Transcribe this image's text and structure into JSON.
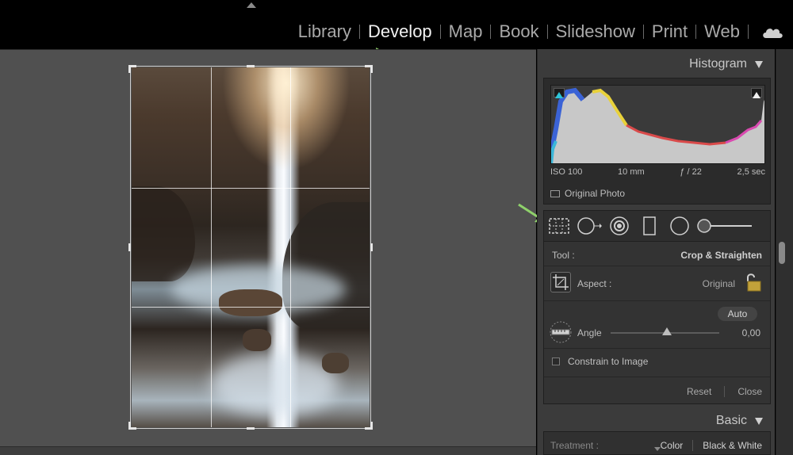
{
  "modules": {
    "items": [
      {
        "label": "Library",
        "active": false
      },
      {
        "label": "Develop",
        "active": true
      },
      {
        "label": "Map",
        "active": false
      },
      {
        "label": "Book",
        "active": false
      },
      {
        "label": "Slideshow",
        "active": false
      },
      {
        "label": "Print",
        "active": false
      },
      {
        "label": "Web",
        "active": false
      }
    ],
    "cloud_icon": "cloud-icon"
  },
  "histogram": {
    "title": "Histogram",
    "iso": "ISO 100",
    "focal": "10 mm",
    "aperture": "ƒ / 22",
    "shutter": "2,5 sec",
    "original_photo": "Original Photo"
  },
  "toolstrip": {
    "icons": [
      "crop-overlay-icon",
      "spot-removal-icon",
      "red-eye-icon",
      "graduated-filter-icon",
      "radial-filter-icon",
      "adjustment-brush-icon"
    ]
  },
  "crop": {
    "tool_label": "Tool :",
    "tool_value": "Crop & Straighten",
    "aspect_label": "Aspect :",
    "aspect_value": "Original",
    "auto_label": "Auto",
    "angle_label": "Angle",
    "angle_value": "0,00",
    "constrain_label": "Constrain to Image",
    "reset_label": "Reset",
    "close_label": "Close"
  },
  "basic": {
    "title": "Basic",
    "treatment_label": "Treatment :",
    "color_label": "Color",
    "bw_label": "Black & White"
  },
  "colors": {
    "accent_arrow": "#8fd16b",
    "active_module": "#f2f2f2",
    "inactive_module": "#a9a9a9"
  }
}
